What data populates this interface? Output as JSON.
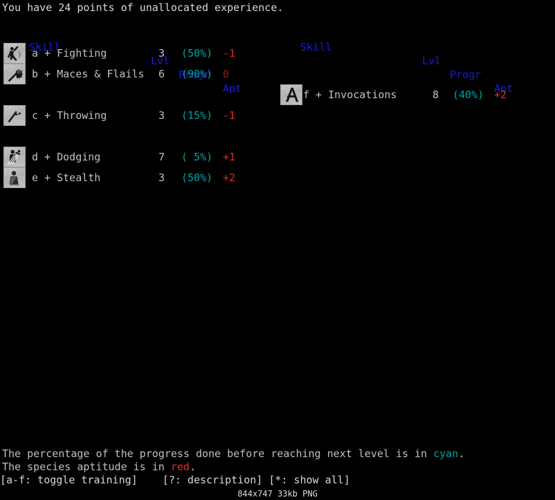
{
  "status": {
    "message": "You have 24 points of unallocated experience."
  },
  "columns": {
    "headers": {
      "skill": "Skill",
      "lvl": "Lvl",
      "progr": "Progr",
      "apt": "Apt"
    }
  },
  "left_column": {
    "rows": [
      {
        "icon": "fighter-sword-shield-icon",
        "label": "a + Fighting",
        "lvl": "3",
        "progr": "(50%)",
        "apt": "-1",
        "apt_zero": false
      },
      {
        "icon": "mace-icon",
        "label": "b + Maces & Flails",
        "lvl": "6",
        "progr": "(90%)",
        "apt": "0",
        "apt_zero": true
      },
      {
        "icon": "throwing-dart-icon",
        "label": "c + Throwing",
        "lvl": "3",
        "progr": "(15%)",
        "apt": "-1",
        "apt_zero": false
      },
      {
        "icon": "dodging-figure-icon",
        "label": "d + Dodging",
        "lvl": "7",
        "progr": "( 5%)",
        "apt": "+1",
        "apt_zero": false
      },
      {
        "icon": "stealth-cloaked-figure-icon",
        "label": "e + Stealth",
        "lvl": "3",
        "progr": "(50%)",
        "apt": "+2",
        "apt_zero": false
      }
    ]
  },
  "right_column": {
    "rows": [
      {
        "icon": "invocations-rune-icon",
        "label": "f + Invocations",
        "lvl": "8",
        "progr": "(40%)",
        "apt": "+2",
        "apt_zero": false
      }
    ]
  },
  "legend": {
    "line1_before": "The percentage of the progress done before reaching next level is in ",
    "line1_keyword": "cyan",
    "line1_after": ".",
    "line2_before": "The species aptitude is in ",
    "line2_keyword": "red",
    "line2_after": "."
  },
  "command_line": {
    "text": "[a-f: toggle training]    [?: description] [*: show all]"
  },
  "watermark": {
    "text": "844x747 33kb PNG"
  },
  "colors": {
    "background": "#000000",
    "header_blue": "#1a1ae6",
    "progress_cyan": "#00a3a3",
    "aptitude_red": "#e03020",
    "aptitude_zero_red": "#9c1d0c",
    "text_gray": "#c0c0c0"
  }
}
